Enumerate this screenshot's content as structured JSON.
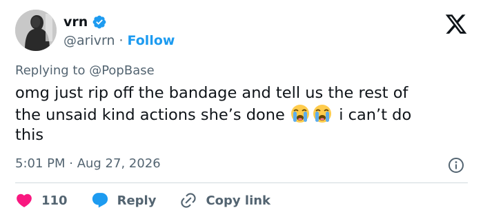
{
  "author": {
    "display_name": "vrn",
    "handle": "@arivrn",
    "separator": "·",
    "follow_label": "Follow",
    "verified_color": "#1d9bf0",
    "avatar_icon": "user-avatar-photo"
  },
  "platform": {
    "logo_icon": "x-logo-icon"
  },
  "reply_context": {
    "text": "Replying to @PopBase"
  },
  "tweet": {
    "line1": "omg just rip off the bandage and tell us the rest of",
    "line2_before": "the unsaid kind actions she’s done",
    "line2_after": " i can’t do",
    "line3": "this",
    "emojis": [
      "loudly-crying-face-emoji",
      "loudly-crying-face-emoji"
    ]
  },
  "meta": {
    "timestamp": "5:01 PM · Aug 27, 2026",
    "info_icon": "info-icon"
  },
  "actions": {
    "like_count": "110",
    "like_color": "#f91880",
    "reply_label": "Reply",
    "reply_color": "#1d9bf0",
    "copy_label": "Copy link"
  },
  "colors": {
    "text": "#0f1419",
    "secondary": "#536471",
    "accent": "#1d9bf0",
    "divider": "#cfd9de"
  }
}
